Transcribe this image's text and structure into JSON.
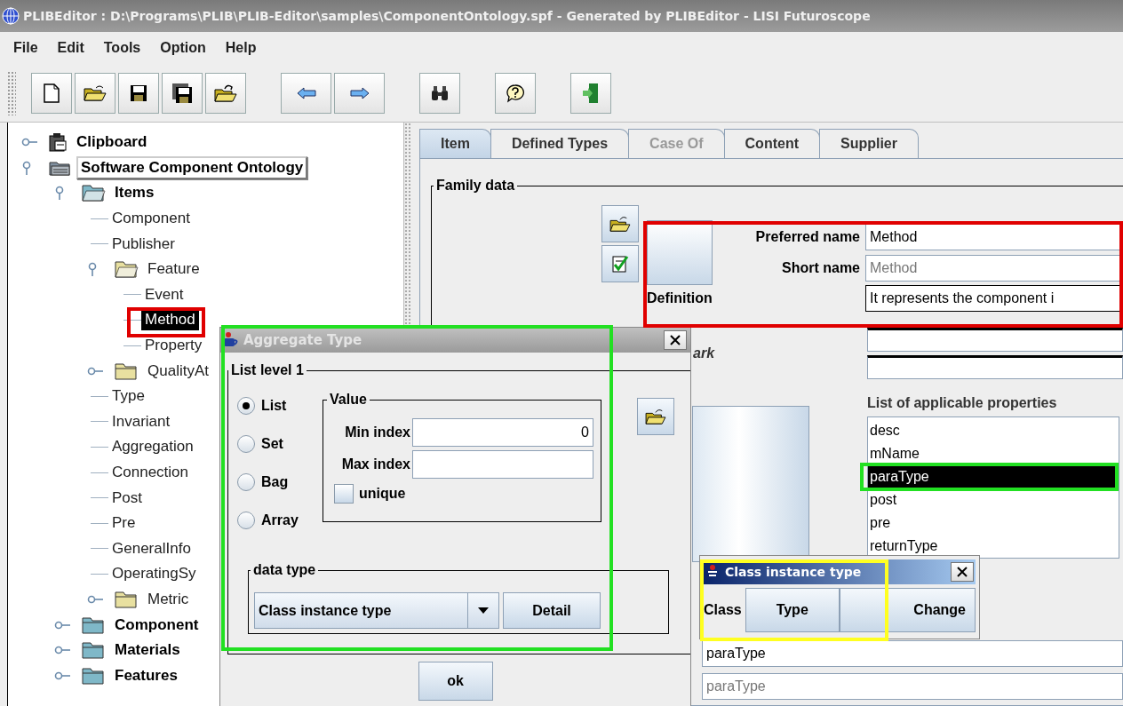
{
  "window": {
    "title": "PLIBEditor : D:\\Programs\\PLIB\\PLIB-Editor\\samples\\ComponentOntology.spf - Generated by PLIBEditor - LISI Futuroscope"
  },
  "menu": [
    "File",
    "Edit",
    "Tools",
    "Option",
    "Help"
  ],
  "toolbar_groups": [
    [
      {
        "kind": "new"
      },
      {
        "kind": "open"
      },
      {
        "kind": "save"
      },
      {
        "kind": "save-all"
      },
      {
        "kind": "reload"
      }
    ],
    [
      {
        "kind": "back"
      },
      {
        "kind": "forward"
      }
    ],
    [
      {
        "kind": "find"
      }
    ],
    [
      {
        "kind": "help"
      }
    ],
    [
      {
        "kind": "exit"
      }
    ]
  ],
  "tree": [
    {
      "label": "Clipboard",
      "kind": "clipboard",
      "expanded": false,
      "selected": false,
      "focused": false
    },
    {
      "label": "Software Component Ontology",
      "kind": "ontology",
      "expanded": true,
      "selected": false,
      "focused": true,
      "children": [
        {
          "label": "Items",
          "kind": "folder",
          "expanded": true,
          "selected": false,
          "focused": false,
          "children": [
            {
              "label": "Component",
              "kind": "leaf",
              "selected": false,
              "focused": false
            },
            {
              "label": "Publisher",
              "kind": "leaf",
              "selected": false,
              "focused": false
            },
            {
              "label": "Feature",
              "kind": "folder",
              "expanded": true,
              "selected": false,
              "focused": false,
              "children": [
                {
                  "label": "Event",
                  "kind": "leaf",
                  "selected": false,
                  "focused": false
                },
                {
                  "label": "Method",
                  "kind": "leaf",
                  "selected": true,
                  "focused": false
                },
                {
                  "label": "Property",
                  "kind": "leaf",
                  "selected": false,
                  "focused": false
                }
              ]
            },
            {
              "label": "QualityAt",
              "kind": "folder",
              "expanded": false,
              "selected": false,
              "focused": false
            },
            {
              "label": "Type",
              "kind": "leaf",
              "selected": false,
              "focused": false
            },
            {
              "label": "Invariant",
              "kind": "leaf",
              "selected": false,
              "focused": false
            },
            {
              "label": "Aggregation",
              "kind": "leaf",
              "selected": false,
              "focused": false
            },
            {
              "label": "Connection",
              "kind": "leaf",
              "selected": false,
              "focused": false
            },
            {
              "label": "Post",
              "kind": "leaf",
              "selected": false,
              "focused": false
            },
            {
              "label": "Pre",
              "kind": "leaf",
              "selected": false,
              "focused": false
            },
            {
              "label": "GeneralInfo",
              "kind": "leaf",
              "selected": false,
              "focused": false
            },
            {
              "label": "OperatingSy",
              "kind": "leaf",
              "selected": false,
              "focused": false
            },
            {
              "label": "Metric",
              "kind": "folder",
              "expanded": false,
              "selected": false,
              "focused": false
            }
          ]
        },
        {
          "label": "Component",
          "kind": "folder",
          "expanded": false,
          "selected": false,
          "focused": false
        },
        {
          "label": "Materials",
          "kind": "folder",
          "expanded": false,
          "selected": false,
          "focused": false
        },
        {
          "label": "Features",
          "kind": "folder",
          "expanded": false,
          "selected": false,
          "focused": false
        }
      ]
    }
  ],
  "tabs": [
    {
      "label": "Item",
      "selected": true,
      "disabled": false
    },
    {
      "label": "Defined Types",
      "selected": false,
      "disabled": false
    },
    {
      "label": "Case Of",
      "selected": false,
      "disabled": true
    },
    {
      "label": "Content",
      "selected": false,
      "disabled": false
    },
    {
      "label": "Supplier",
      "selected": false,
      "disabled": false
    }
  ],
  "family_data": {
    "title": "Family data",
    "fields": [
      {
        "label": "Preferred name",
        "value": "Method",
        "disabled": false
      },
      {
        "label": "Short name",
        "value": "Method",
        "disabled": true
      }
    ],
    "definition": {
      "label": "Definition",
      "value": "It represents the component i"
    },
    "remark": {
      "label": "ark"
    },
    "properties": {
      "label": "List of applicable properties",
      "items": [
        {
          "name": "desc",
          "selected": false
        },
        {
          "name": "mName",
          "selected": false
        },
        {
          "name": "paraType",
          "selected": true
        },
        {
          "name": "post",
          "selected": false
        },
        {
          "name": "pre",
          "selected": false
        },
        {
          "name": "returnType",
          "selected": false
        }
      ]
    },
    "type_fields": [
      {
        "value": "paraType",
        "disabled": false
      },
      {
        "value": "paraType",
        "disabled": true
      }
    ]
  },
  "aggregate_dialog": {
    "title": "Aggregate Type",
    "group": "List level 1",
    "options": [
      {
        "label": "List",
        "selected": true
      },
      {
        "label": "Set",
        "selected": false
      },
      {
        "label": "Bag",
        "selected": false
      },
      {
        "label": "Array",
        "selected": false
      }
    ],
    "value_group": "Value",
    "min_index": {
      "label": "Min index",
      "value": "0"
    },
    "max_index": {
      "label": "Max index"
    },
    "unique": {
      "label": "unique",
      "checked": false
    },
    "data_type": {
      "title": "data type",
      "value": "Class instance type"
    },
    "detail_button": "Detail",
    "ok_button": "ok"
  },
  "class_dialog": {
    "title": "Class instance type",
    "label": "Class",
    "buttons": [
      "Type",
      "Change"
    ]
  }
}
